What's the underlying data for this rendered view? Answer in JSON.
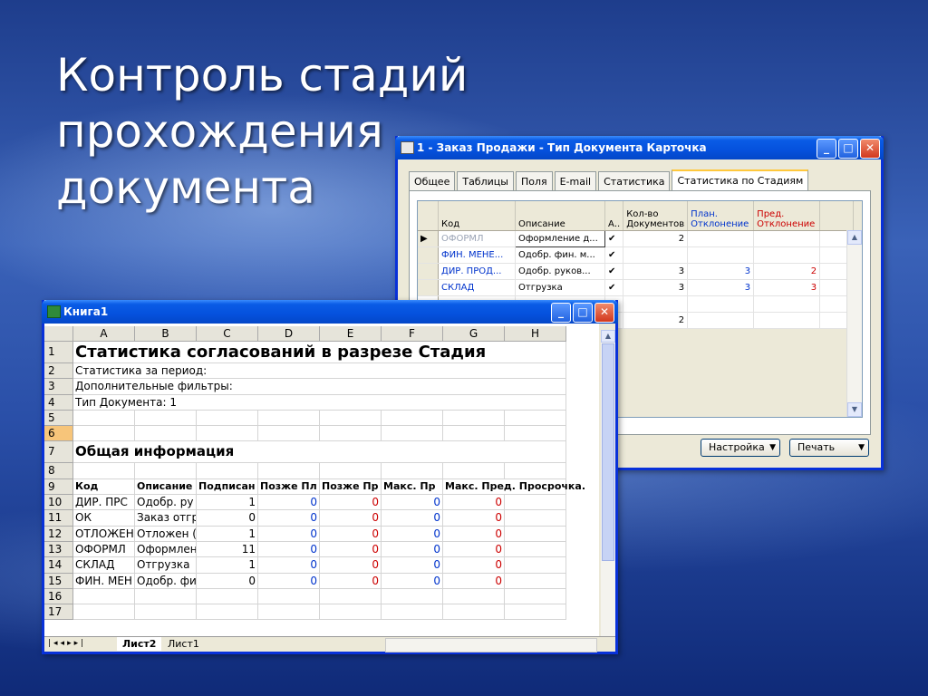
{
  "slide": {
    "title_line1": "Контроль стадий прохождения",
    "title_line2": "документа"
  },
  "order_window": {
    "title": "1 - Заказ Продажи - Тип Документа Карточка",
    "tabs": [
      "Общее",
      "Таблицы",
      "Поля",
      "E-mail",
      "Статистика",
      "Статистика по Стадиям"
    ],
    "columns": {
      "code": "Код",
      "description": "Описание",
      "active": "А..",
      "doc_count_1": "Кол-во",
      "doc_count_2": "Документов",
      "plan_dev_1": "План.",
      "plan_dev_2": "Отклонение",
      "pred_dev_1": "Пред.",
      "pred_dev_2": "Отклонение"
    },
    "rows": [
      {
        "code": "ОФОРМЛ",
        "description": "Оформление д...",
        "active": "✔",
        "count": "2",
        "plan": "",
        "pred": ""
      },
      {
        "code": "ФИН. МЕНЕ...",
        "description": "Одобр. фин. м...",
        "active": "✔",
        "count": "",
        "plan": "",
        "pred": ""
      },
      {
        "code": "ДИР. ПРОД...",
        "description": "Одобр. руков...",
        "active": "✔",
        "count": "3",
        "plan": "3",
        "pred": "2"
      },
      {
        "code": "СКЛАД",
        "description": "Отгрузка",
        "active": "✔",
        "count": "3",
        "plan": "3",
        "pred": "3"
      }
    ],
    "total_row": {
      "count": "2"
    },
    "settings_button": "Настройка",
    "print_button": "Печать"
  },
  "book_window": {
    "title": "Книга1",
    "col_headers": [
      "A",
      "B",
      "C",
      "D",
      "E",
      "F",
      "G",
      "H"
    ],
    "row_numbers": [
      "1",
      "2",
      "3",
      "4",
      "5",
      "6",
      "7",
      "8",
      "9",
      "10",
      "11",
      "12",
      "13",
      "14",
      "15",
      "16",
      "17"
    ],
    "sheet_title": "Статистика согласований в разрезе Стадия",
    "period_label": "Статистика за период:",
    "filters_label": "Дополнительные фильтры:",
    "doc_type_label": "Тип Документа: 1",
    "section_title": "Общая информация",
    "table_headers": [
      "Код",
      "Описание",
      "Подписан",
      "Позже Пл",
      "Позже Пр",
      "Макс. Пр",
      "Макс. Пред. Просрочка."
    ],
    "table_rows": [
      {
        "code": "ДИР. ПРС",
        "desc": "Одобр. ру",
        "signed": "1",
        "late_plan": "0",
        "late_pred": "0",
        "max_plan": "0",
        "max_pred": "0"
      },
      {
        "code": "ОК",
        "desc": "Заказ отгр",
        "signed": "0",
        "late_plan": "0",
        "late_pred": "0",
        "max_plan": "0",
        "max_pred": "0"
      },
      {
        "code": "ОТЛОЖЕН",
        "desc": "Отложен (",
        "signed": "1",
        "late_plan": "0",
        "late_pred": "0",
        "max_plan": "0",
        "max_pred": "0"
      },
      {
        "code": "ОФОРМЛ",
        "desc": "Оформлен",
        "signed": "11",
        "late_plan": "0",
        "late_pred": "0",
        "max_plan": "0",
        "max_pred": "0"
      },
      {
        "code": "СКЛАД",
        "desc": "Отгрузка",
        "signed": "1",
        "late_plan": "0",
        "late_pred": "0",
        "max_plan": "0",
        "max_pred": "0"
      },
      {
        "code": "ФИН. МЕН",
        "desc": "Одобр. фи",
        "signed": "0",
        "late_plan": "0",
        "late_pred": "0",
        "max_plan": "0",
        "max_pred": "0"
      }
    ],
    "sheet_tabs": [
      "Лист2",
      "Лист1"
    ]
  },
  "colors": {
    "blue_value": "#0033cc",
    "red_value": "#cc0000",
    "selected_row_header": "#f7c57a"
  }
}
